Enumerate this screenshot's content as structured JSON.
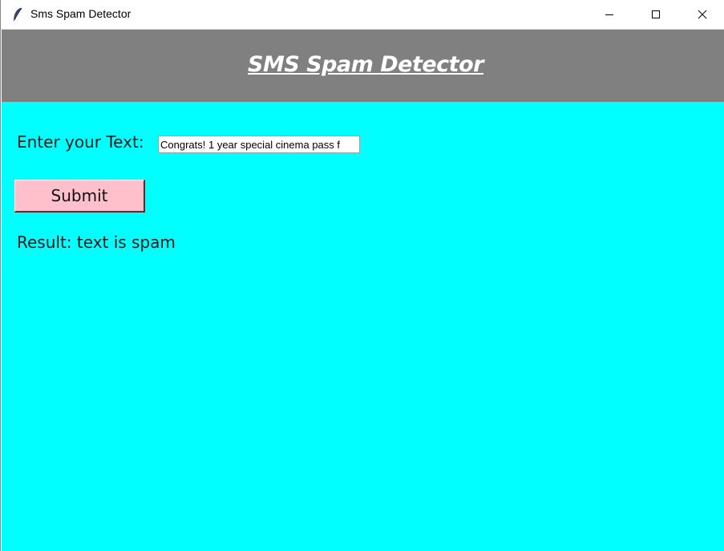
{
  "window": {
    "title": "Sms Spam Detector",
    "app_icon": "feather-icon",
    "controls": {
      "minimize_icon": "minimize-icon",
      "maximize_icon": "maximize-icon",
      "close_icon": "close-icon"
    }
  },
  "header": {
    "title": "SMS Spam Detector",
    "background_color": "#808080",
    "text_color": "#ffffff"
  },
  "form": {
    "input_label": "Enter your Text:",
    "input_value": "Congrats! 1 year special cinema pass f",
    "submit_label": "Submit",
    "submit_color": "#ffc0cb"
  },
  "result": {
    "text": "Result: text is spam"
  },
  "colors": {
    "content_background": "#00ffff"
  }
}
